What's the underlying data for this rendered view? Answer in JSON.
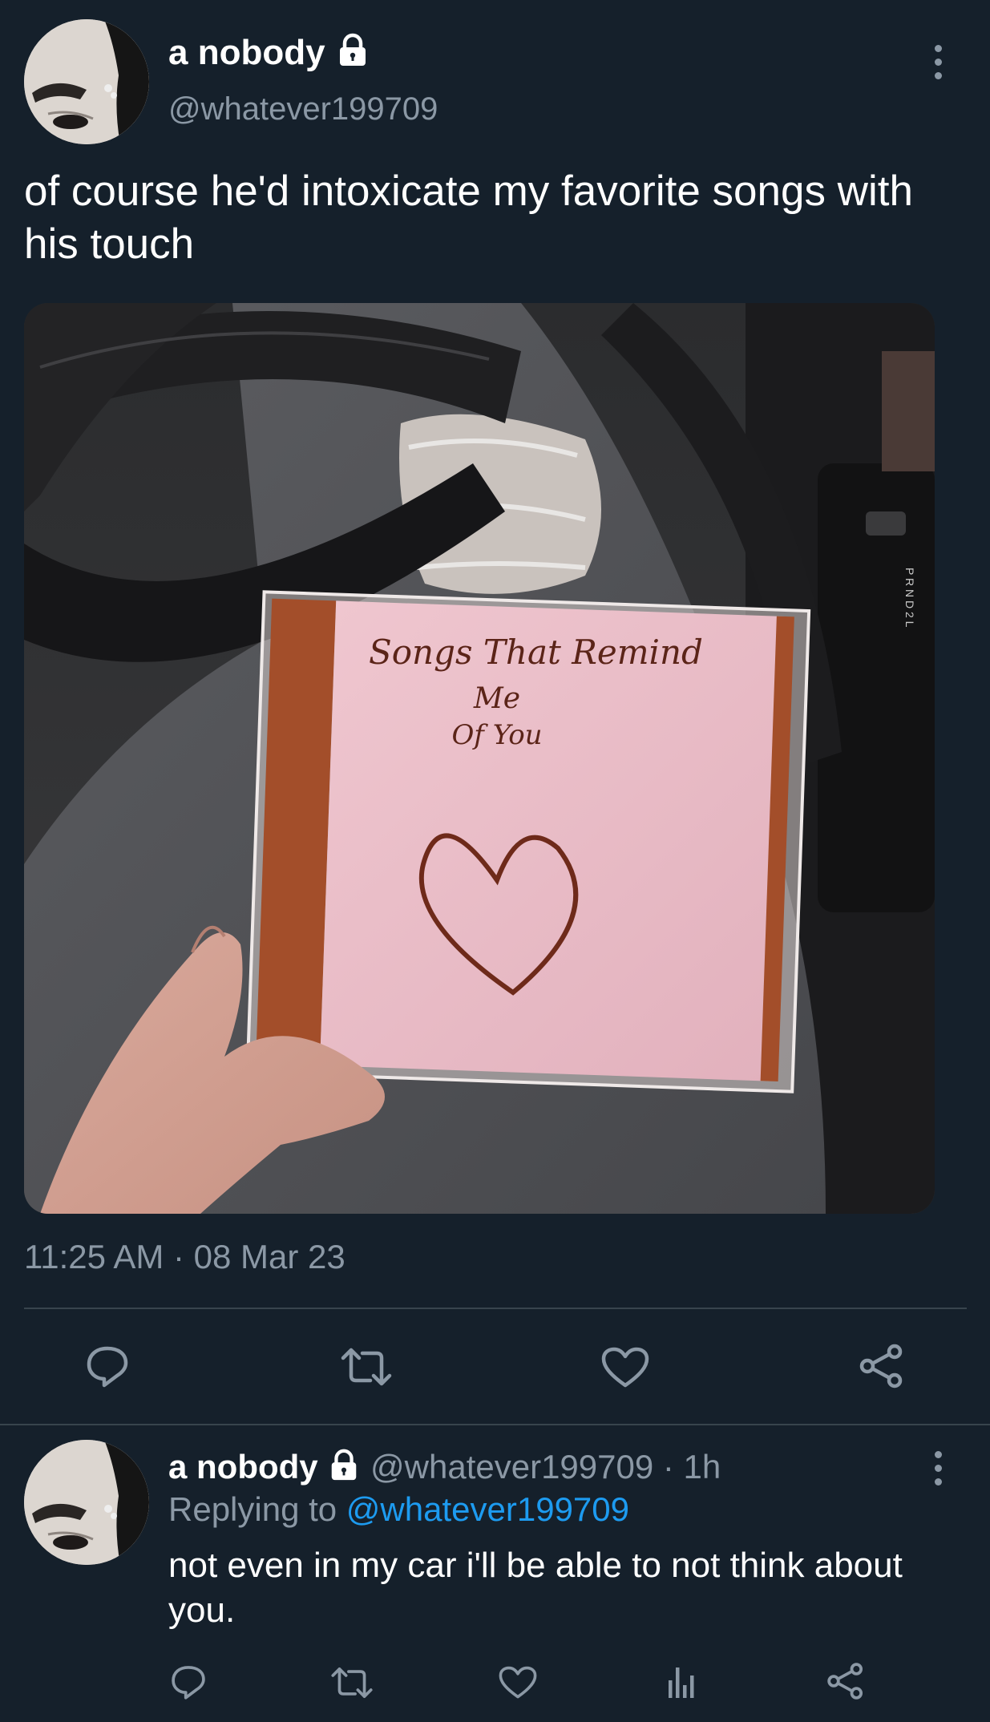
{
  "tweet": {
    "display_name": "a nobody",
    "handle": "@whatever199709",
    "text": "of course he'd intoxicate my favorite songs with his touch",
    "cd_text_line1": "Songs That Remind",
    "cd_text_line2": "Me",
    "cd_text_line3": "Of You",
    "shifter_letters": "P R N D 2 L",
    "timestamp": "11:25 AM · 08 Mar 23",
    "icons": [
      "lock-icon",
      "more-icon",
      "reply-icon",
      "retweet-icon",
      "like-icon",
      "share-icon"
    ]
  },
  "reply": {
    "display_name": "a nobody",
    "handle_time": "@whatever199709 · 1h",
    "replying_prefix": "Replying to",
    "replying_handle": "@whatever199709",
    "text": "not even in my car i'll be able to not think about you.",
    "icons": [
      "reply-icon",
      "retweet-icon",
      "like-icon",
      "analytics-icon",
      "share-icon"
    ]
  },
  "colors": {
    "background": "#15202b",
    "muted": "#8b98a5",
    "link": "#1d9bf0",
    "divider": "#38444d"
  }
}
